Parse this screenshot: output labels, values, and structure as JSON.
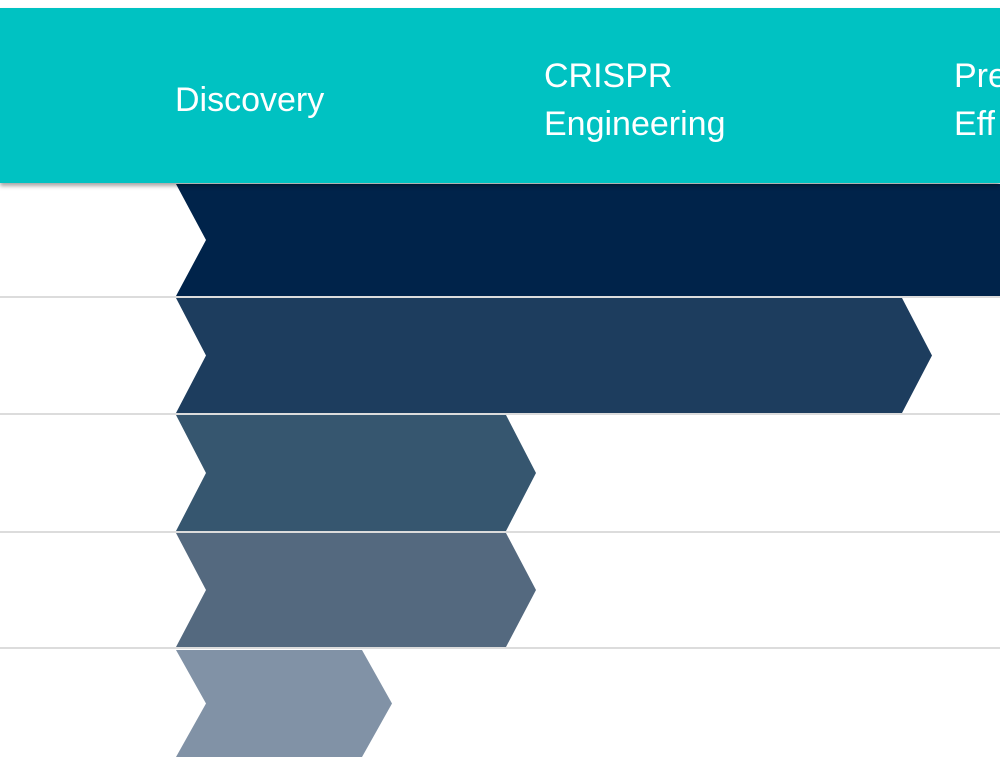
{
  "header": {
    "stages": [
      {
        "label": "Discovery"
      },
      {
        "label": "CRISPR\nEngineering"
      },
      {
        "label": "Pre\nEff"
      }
    ]
  },
  "programs": [
    {
      "progress_stage": 3.0,
      "color": "#00234a"
    },
    {
      "progress_stage": 2.1,
      "color": "#1d3d5e"
    },
    {
      "progress_stage": 1.0,
      "color": "#36566f"
    },
    {
      "progress_stage": 1.0,
      "color": "#54697f"
    },
    {
      "progress_stage": 0.6,
      "color": "#8192a6"
    }
  ],
  "colors": {
    "header_bg": "#00c2c2",
    "divider": "#dcdcdc"
  }
}
